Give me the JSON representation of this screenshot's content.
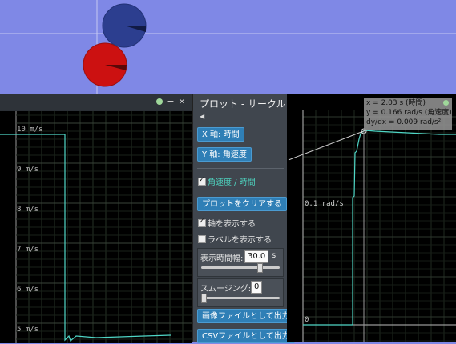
{
  "simulation": {
    "bg_color": "#7f88e6",
    "disk_colors": [
      "#2c3e8f",
      "#cc1111"
    ]
  },
  "left_window": {
    "buttons": [
      "dot",
      "−",
      "×"
    ],
    "y_tick_labels": [
      "10 m/s",
      "9 m/s",
      "8 m/s",
      "7 m/s",
      "6 m/s",
      "5 m/s"
    ],
    "line_color": "#4fd6c6"
  },
  "panel": {
    "title": "プロット - サークル",
    "collapse_icon": "triangle-left-icon",
    "x_axis_button": "X 軸: 時間",
    "y_axis_button": "Y 軸: 角速度",
    "series_checkbox": "角速度 / 時間",
    "clear_button": "プロットをクリアする",
    "show_axes_label": "軸を表示する",
    "show_axes_checked": true,
    "show_labels_label": "ラベルを表示する",
    "show_labels_checked": false,
    "time_width_label": "表示時間幅:",
    "time_width_value": "30.0",
    "time_width_unit": "s",
    "time_width_fraction": 0.75,
    "smoothing_label": "スムージング:",
    "smoothing_value": "0",
    "smoothing_fraction": 0.0,
    "save_image_button": "画像ファイルとして出力",
    "save_csv_button": "CSVファイルとして出力"
  },
  "right_window": {
    "y_tick_labels": [
      "0.1 rad/s",
      "0"
    ],
    "line_color": "#4fd6c6"
  },
  "tooltip": {
    "x_line": "x = 2.03 s (時間)",
    "y_line": "y = 0.166 rad/s (角速度)",
    "slope_line": "dy/dx = 0.009 rad/s²"
  }
}
